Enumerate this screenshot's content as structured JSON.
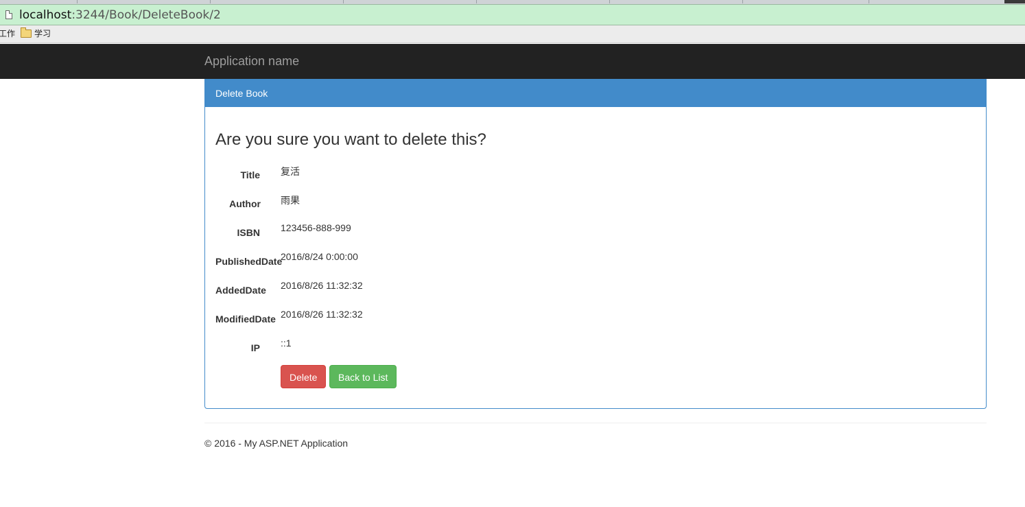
{
  "browser": {
    "url_host": "localhost",
    "url_path": ":3244/Book/DeleteBook/2",
    "bookmarks": [
      "工作",
      "学习"
    ]
  },
  "app": {
    "brand": "Application name"
  },
  "panel": {
    "heading": "Delete Book",
    "question": "Are you sure you want to delete this?",
    "fields": [
      {
        "label": "Title",
        "value": "复活"
      },
      {
        "label": "Author",
        "value": "雨果"
      },
      {
        "label": "ISBN",
        "value": "123456-888-999"
      },
      {
        "label": "PublishedDate",
        "value": "2016/8/24 0:00:00"
      },
      {
        "label": "AddedDate",
        "value": "2016/8/26 11:32:32"
      },
      {
        "label": "ModifiedDate",
        "value": "2016/8/26 11:32:32"
      },
      {
        "label": "IP",
        "value": "::1"
      }
    ],
    "delete_label": "Delete",
    "back_label": "Back to List"
  },
  "footer": {
    "text": "© 2016 - My ASP.NET Application"
  },
  "colors": {
    "navbar": "#222222",
    "primary": "#428bca",
    "danger": "#d9534f",
    "success": "#5cb85c"
  }
}
